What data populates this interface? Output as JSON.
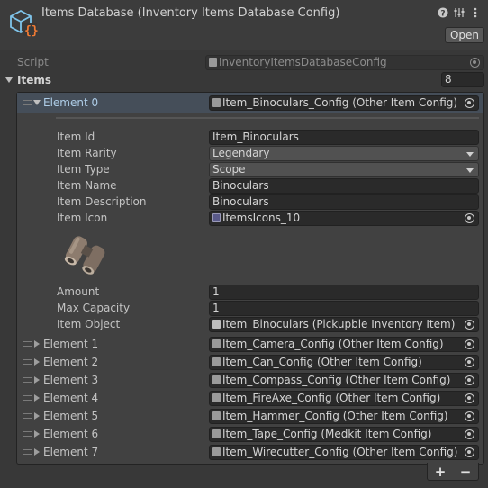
{
  "header": {
    "title": "Items Database (Inventory Items Database Config)",
    "open_label": "Open",
    "icons": [
      "scriptable-object-icon",
      "help-icon",
      "preset-icon",
      "more-icon"
    ]
  },
  "script_row": {
    "label": "Script",
    "value": "InventoryItemsDatabaseConfig"
  },
  "items_row": {
    "label": "Items",
    "count": "8"
  },
  "element0": {
    "label": "Element 0",
    "value": "Item_Binoculars_Config (Other Item Config)",
    "fields": {
      "item_id": {
        "label": "Item Id",
        "value": "Item_Binoculars"
      },
      "item_rarity": {
        "label": "Item Rarity",
        "value": "Legendary"
      },
      "item_type": {
        "label": "Item Type",
        "value": "Scope"
      },
      "item_name": {
        "label": "Item Name",
        "value": "Binoculars"
      },
      "item_description": {
        "label": "Item Description",
        "value": "Binoculars"
      },
      "item_icon": {
        "label": "Item Icon",
        "value": "ItemsIcons_10"
      },
      "amount": {
        "label": "Amount",
        "value": "1"
      },
      "max_capacity": {
        "label": "Max Capacity",
        "value": "1"
      },
      "item_object": {
        "label": "Item Object",
        "value": "Item_Binoculars (Pickupble Inventory Item)"
      }
    }
  },
  "elements": [
    {
      "label": "Element 1",
      "value": "Item_Camera_Config (Other Item Config)"
    },
    {
      "label": "Element 2",
      "value": "Item_Can_Config (Other Item Config)"
    },
    {
      "label": "Element 3",
      "value": "Item_Compass_Config (Other Item Config)"
    },
    {
      "label": "Element 4",
      "value": "Item_FireAxe_Config (Other Item Config)"
    },
    {
      "label": "Element 5",
      "value": "Item_Hammer_Config (Other Item Config)"
    },
    {
      "label": "Element 6",
      "value": "Item_Tape_Config (Medkit Item Config)"
    },
    {
      "label": "Element 7",
      "value": "Item_Wirecutter_Config (Other Item Config)"
    }
  ],
  "footer": {
    "add_label": "+",
    "remove_label": "−"
  },
  "colors": {
    "background": "#383838",
    "highlight": "#454e59",
    "field": "#2a2a2a"
  }
}
